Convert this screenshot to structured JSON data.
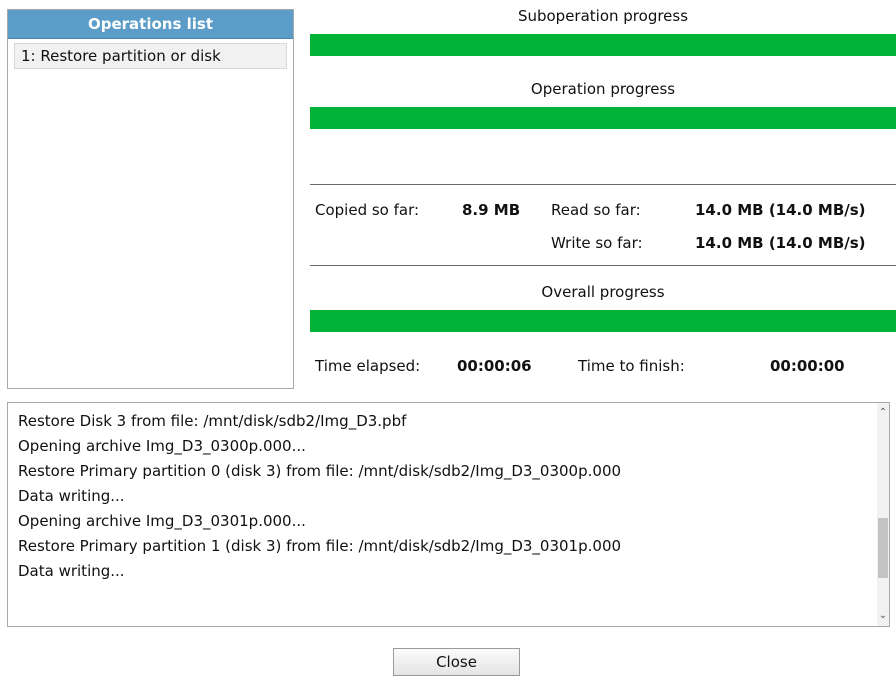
{
  "operations_list": {
    "header": "Operations list",
    "items": [
      "1: Restore partition or disk"
    ]
  },
  "progress": {
    "suboperation_label": "Suboperation progress",
    "suboperation_fraction": 1.0,
    "operation_label": "Operation progress",
    "operation_fraction": 1.0,
    "overall_label": "Overall progress",
    "overall_fraction": 1.0
  },
  "stats": {
    "copied_label": "Copied so far:",
    "copied_value": "8.9 MB",
    "read_label": "Read so far:",
    "read_value": "14.0 MB (14.0 MB/s)",
    "write_label": "Write so far:",
    "write_value": "14.0 MB (14.0 MB/s)",
    "elapsed_label": "Time elapsed:",
    "elapsed_value": "00:00:06",
    "finish_label": "Time to finish:",
    "finish_value": "00:00:00"
  },
  "log": {
    "lines": [
      "Restore Disk 3 from file: /mnt/disk/sdb2/Img_D3.pbf",
      "Opening archive Img_D3_0300p.000...",
      "Restore Primary partition 0 (disk 3) from file: /mnt/disk/sdb2/Img_D3_0300p.000",
      "Data writing...",
      "Opening archive Img_D3_0301p.000...",
      "Restore Primary partition 1 (disk 3) from file: /mnt/disk/sdb2/Img_D3_0301p.000",
      "Data writing..."
    ]
  },
  "buttons": {
    "close_label": "Close"
  },
  "colors": {
    "progress_fill": "#00b336",
    "header_bg": "#5c9cc8"
  }
}
